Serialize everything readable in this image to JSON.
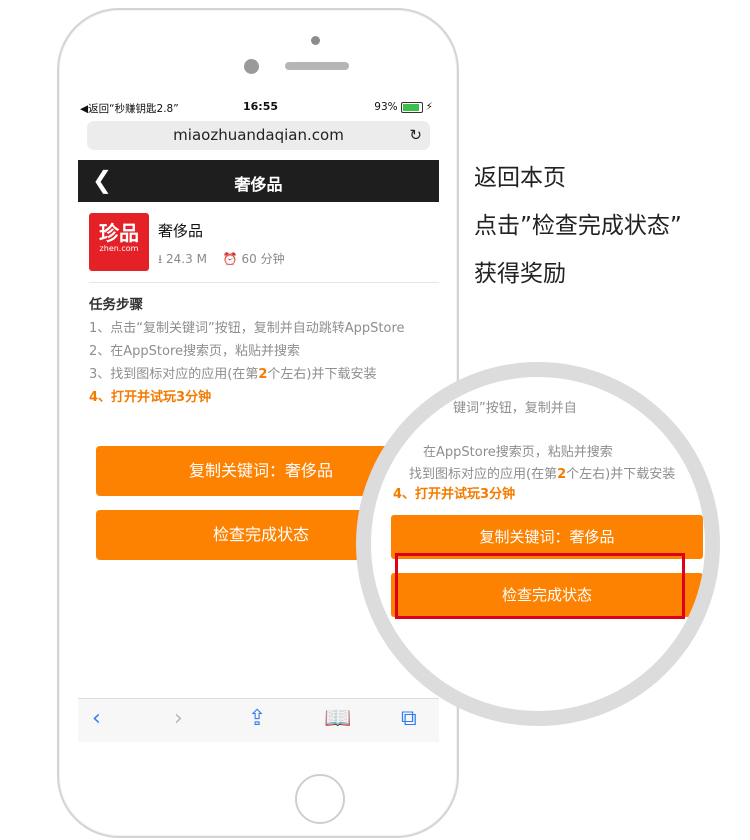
{
  "status_bar": {
    "back_app": "◀返回“秒赚钥匙2.8”",
    "time": "16:55",
    "battery": "93%"
  },
  "browser": {
    "url": "miaozhuandaqian.com"
  },
  "nav": {
    "title": "奢侈品"
  },
  "app": {
    "logo_main": "珍品",
    "logo_sub": "zhen.com",
    "name": "奢侈品",
    "size": "24.3 M",
    "time": "60 分钟"
  },
  "steps": {
    "heading": "任务步骤",
    "s1": "1、点击“复制关键词”按钮，复制并自动跳转AppStore",
    "s2": "2、在AppStore搜索页，粘贴并搜索",
    "s3_pre": "3、找到图标对应的应用(在第",
    "s3_num": "2",
    "s3_post": "个左右)并下载安装",
    "s4": "4、打开并试玩3分钟"
  },
  "buttons": {
    "copy": "复制关键词：奢侈品",
    "check": "检查完成状态"
  },
  "captions": [
    "返回本页",
    "点击”检查完成状态”",
    "获得奖励"
  ],
  "magnifier": {
    "line1": "键词”按钮，复制并自",
    "line2": "在AppStore搜索页，粘贴并搜索",
    "line3_pre": "找到图标对应的应用(在第",
    "line3_num": "2",
    "line3_post": "个左右)并下载安装",
    "line4": "4、打开并试玩3分钟"
  },
  "colors": {
    "accent": "#fd8202",
    "highlight": "#e0001b"
  }
}
